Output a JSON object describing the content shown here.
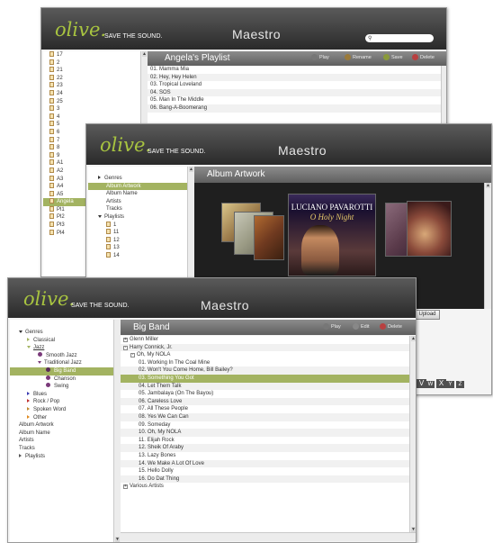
{
  "brand": {
    "logo": "olive.",
    "tagline": "SAVE THE SOUND.",
    "app": "Maestro"
  },
  "colors": {
    "accent": "#a3b361",
    "logo": "#a8c440"
  },
  "win1": {
    "tree": [
      "17",
      "2",
      "21",
      "22",
      "23",
      "24",
      "25",
      "3",
      "4",
      "5",
      "6",
      "7",
      "8",
      "9",
      "A1",
      "A2",
      "A3",
      "A4",
      "A5",
      "Angela",
      "Pl1",
      "Pl2",
      "Pl3",
      "Pl4"
    ],
    "tree_selected": 19,
    "panel_title": "Angela's Playlist",
    "actions": {
      "play": "Play",
      "rename": "Rename",
      "save": "Save",
      "delete": "Delete"
    },
    "tracks": [
      "01. Mamma Mia",
      "02. Hey, Hey Helen",
      "03. Tropical Loveland",
      "04. SOS",
      "05. Man In The Middle",
      "06. Bang-A-Boomerang"
    ]
  },
  "win2": {
    "tree": [
      "Genres",
      "Album Artwork",
      "Album Name",
      "Artists",
      "Tracks",
      "Playlists",
      "1",
      "11",
      "12",
      "13",
      "14"
    ],
    "tree_selected": 1,
    "panel_title": "Album Artwork",
    "covers": {
      "main_artist": "LUCIANO PAVAROTTI",
      "main_title": "O Holy Night"
    },
    "upload": "Upload",
    "navs": [
      "V",
      "W",
      "X",
      "Y",
      "Z"
    ]
  },
  "win3": {
    "tree": {
      "genres": "Genres",
      "classical": "Classical",
      "jazz": "Jazz",
      "smooth_jazz": "Smooth Jazz",
      "traditional_jazz": "Traditional Jazz",
      "big_band": "Big Band",
      "chanson": "Chanson",
      "swing": "Swing",
      "blues": "Blues",
      "rock_pop": "Rock / Pop",
      "spoken_word": "Spoken Word",
      "other": "Other",
      "album_artwork": "Album Artwork",
      "album_name": "Album Name",
      "artists": "Artists",
      "tracks": "Tracks",
      "playlists": "Playlists"
    },
    "panel_title": "Big Band",
    "actions": {
      "play": "Play",
      "edit": "Edit",
      "delete": "Delete"
    },
    "artist1": "Glenn Miller",
    "artist2": "Harry Connick, Jr.",
    "album": "Oh, My NOLA",
    "tracks": [
      "01. Working In The Coal Mine",
      "02. Won't You Come Home, Bill Bailey?",
      "03. Something You Got",
      "04. Let Them Talk",
      "05. Jambalaya (On The Bayou)",
      "06. Careless Love",
      "07. All These People",
      "08. Yes We Can Can",
      "09. Someday",
      "10. Oh, My NOLA",
      "11. Elijah Rock",
      "12. Sheik Of Araby",
      "13. Lazy Bones",
      "14. We Make A Lot Of Love",
      "15. Hello Dolly",
      "16. Do Dat Thing"
    ],
    "track_selected": 2,
    "artist3": "Various Artists"
  }
}
